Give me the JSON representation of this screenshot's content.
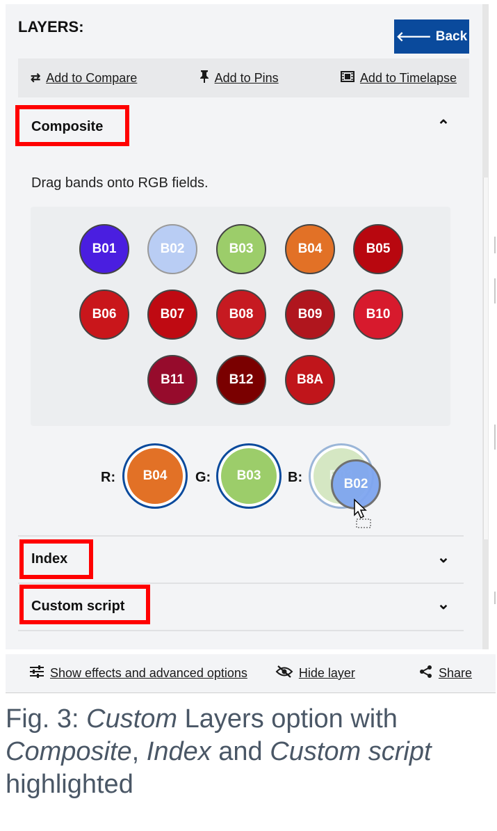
{
  "header": {
    "title": "LAYERS:",
    "back_label": "Back"
  },
  "toolbar": {
    "compare": {
      "label": "Add to Compare",
      "icon": "swap-arrows-icon"
    },
    "pins": {
      "label": "Add to Pins",
      "icon": "pin-icon"
    },
    "timelapse": {
      "label": "Add to Timelapse",
      "icon": "film-icon"
    }
  },
  "composite": {
    "title": "Composite",
    "hint": "Drag bands onto RGB fields.",
    "bands": [
      {
        "label": "B01",
        "color": "#4a1ee0"
      },
      {
        "label": "B02",
        "color": "#b9cdf4"
      },
      {
        "label": "B03",
        "color": "#9ccd6a"
      },
      {
        "label": "B04",
        "color": "#e27126"
      },
      {
        "label": "B05",
        "color": "#b8070f"
      },
      {
        "label": "B06",
        "color": "#c9161b"
      },
      {
        "label": "B07",
        "color": "#bf0a12"
      },
      {
        "label": "B08",
        "color": "#c61a21"
      },
      {
        "label": "B09",
        "color": "#b0161e"
      },
      {
        "label": "B10",
        "color": "#d71a2d"
      },
      {
        "label": "B11",
        "color": "#960b2c"
      },
      {
        "label": "B12",
        "color": "#7a0000"
      },
      {
        "label": "B8A",
        "color": "#c0151b"
      }
    ],
    "rgb": {
      "r": {
        "label": "R:",
        "band": "B04",
        "color": "#e27126"
      },
      "g": {
        "label": "G:",
        "band": "B03",
        "color": "#9ccd6a"
      },
      "b": {
        "label": "B:",
        "band": "B03",
        "color": "#d5e7c3"
      }
    },
    "dragging": {
      "band": "B02",
      "color": "#7fa6f0"
    }
  },
  "index": {
    "title": "Index"
  },
  "custom_script": {
    "title": "Custom script"
  },
  "footer": {
    "effects": {
      "label": "Show effects and advanced options",
      "icon": "sliders-icon"
    },
    "hide": {
      "label": "Hide layer",
      "icon": "eye-off-icon"
    },
    "share": {
      "label": "Share",
      "icon": "share-icon"
    }
  },
  "caption": {
    "prefix": "Fig. 3: ",
    "custom": "Custom",
    "mid1": " Layers option with ",
    "composite": "Composite",
    "comma": ", ",
    "index": "Index",
    "and": " and ",
    "custom_script": "Custom script",
    "suffix": " highlighted"
  },
  "highlight_color": "#ff0000",
  "accent_color": "#0a4a9c"
}
